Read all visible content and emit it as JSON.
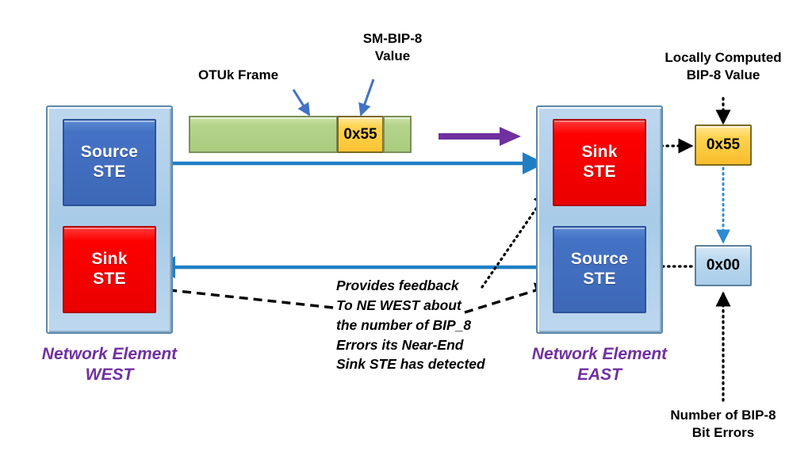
{
  "diagram": {
    "title_present": false,
    "colors": {
      "source_ste": "#4472C4",
      "sink_ste": "#FE0000",
      "chassis": "#BDD7EE",
      "ne_label": "#7030A0",
      "frame_body": "#B5D48B",
      "bip_value": "#FFD34F",
      "link_line": "#1F7FC4",
      "transport_arrow": "#7030A0",
      "callout_arrow": "#4472C4",
      "feedback_arrow": "#000000"
    }
  },
  "west": {
    "label_line1": "Network Element",
    "label_line2": "WEST",
    "source_ste": {
      "line1": "Source",
      "line2": "STE"
    },
    "sink_ste": {
      "line1": "Sink",
      "line2": "STE"
    }
  },
  "east": {
    "label_line1": "Network Element",
    "label_line2": "EAST",
    "sink_ste": {
      "line1": "Sink",
      "line2": "STE"
    },
    "source_ste": {
      "line1": "Source",
      "line2": "STE"
    }
  },
  "frame": {
    "frame_label": "OTUk Frame",
    "bip_label_line1": "SM-BIP-8",
    "bip_label_line2": "Value",
    "bip_value": "0x55"
  },
  "values": {
    "locally_computed_label_line1": "Locally Computed",
    "locally_computed_label_line2": "BIP-8 Value",
    "received_bip": "0x55",
    "error_count": "0x00",
    "error_label_line1": "Number of BIP-8",
    "error_label_line2": "Bit Errors"
  },
  "feedback_note": {
    "line1": "Provides feedback",
    "line2": "To NE WEST about",
    "line3": "the number of BIP_8",
    "line4": "Errors its Near-End",
    "line5": "Sink STE has detected"
  }
}
